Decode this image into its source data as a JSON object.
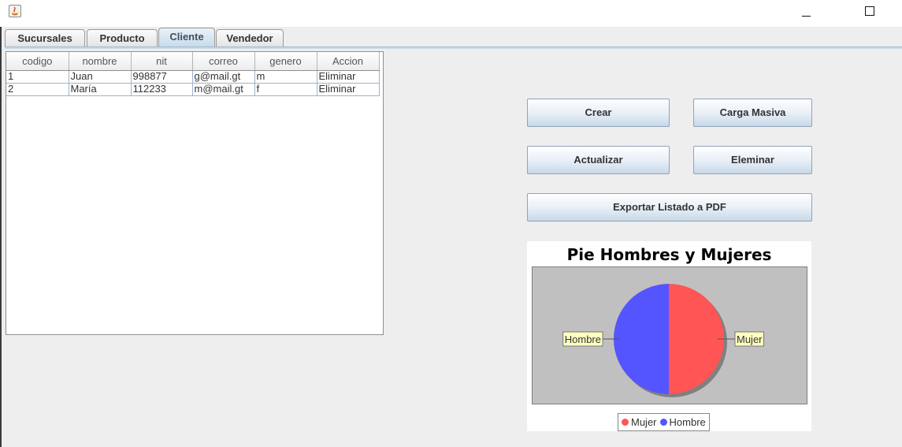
{
  "window": {
    "icon": "java-app-icon",
    "controls": [
      "minimize-icon",
      "maximize-icon"
    ]
  },
  "tabs": [
    {
      "label": "Sucursales",
      "active": false
    },
    {
      "label": "Producto",
      "active": false
    },
    {
      "label": "Cliente",
      "active": true
    },
    {
      "label": "Vendedor",
      "active": false
    }
  ],
  "table": {
    "columns": [
      "codigo",
      "nombre",
      "nit",
      "correo",
      "genero",
      "Accion"
    ],
    "rows": [
      [
        "1",
        "Juan",
        "998877",
        "g@mail.gt",
        "m",
        "Eliminar"
      ],
      [
        "2",
        "María",
        "112233",
        "m@mail.gt",
        "f",
        "Eliminar"
      ]
    ]
  },
  "buttons": {
    "crear": "Crear",
    "carga_masiva": "Carga Masiva",
    "actualizar": "Actualizar",
    "eliminar": "Eleminar",
    "exportar": "Exportar Listado a PDF"
  },
  "chart_data": {
    "type": "pie",
    "title": "Pie Hombres y Mujeres",
    "slices": [
      {
        "label": "Mujer",
        "value": 1,
        "color": "#ff5555"
      },
      {
        "label": "Hombre",
        "value": 1,
        "color": "#5555ff"
      }
    ],
    "legend": [
      "Mujer",
      "Hombre"
    ],
    "legend_position": "bottom"
  }
}
